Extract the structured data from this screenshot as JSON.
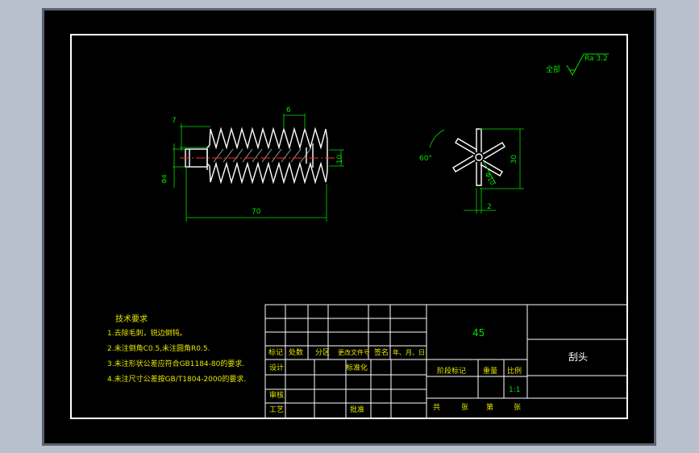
{
  "roughness": {
    "label": "全部",
    "value": "Ra 3.2"
  },
  "dimensions": {
    "pitch": "6",
    "tooth_height": "7",
    "diameter_small": "Φ4",
    "bore": "10",
    "total_length": "70",
    "angle": "60°",
    "height": "30",
    "blade_dia": "Φ10",
    "blade_width": "2"
  },
  "tech_requirements": {
    "title": "技术要求",
    "items": [
      "1.去除毛刺，锐边倒钝。",
      "2.未注倒角C0.5,未注圆角R0.5.",
      "3.未注形状公差应符合GB1184-80的要求.",
      "4.未注尺寸公差按GB/T1804-2000的要求."
    ]
  },
  "title_block": {
    "material": "45",
    "part_name": "刮头",
    "rev_headers": [
      "标记",
      "处数",
      "分区",
      "更改文件号",
      "签名",
      "年、月、日"
    ],
    "design": "设计",
    "standardize": "标准化",
    "review": "审核",
    "process": "工艺",
    "approve": "批准",
    "stage_mark": "阶段标记",
    "weight": "重量",
    "scale": "比例",
    "scale_value": "1:1",
    "sheets": [
      "共",
      "张",
      "第",
      "张"
    ]
  },
  "colors": {
    "background": "#000000",
    "border": "#ffffff",
    "annotation": "#e6e600",
    "text": "#00e000",
    "dimension": "#00e000",
    "centerline": "#ff2a2a"
  }
}
